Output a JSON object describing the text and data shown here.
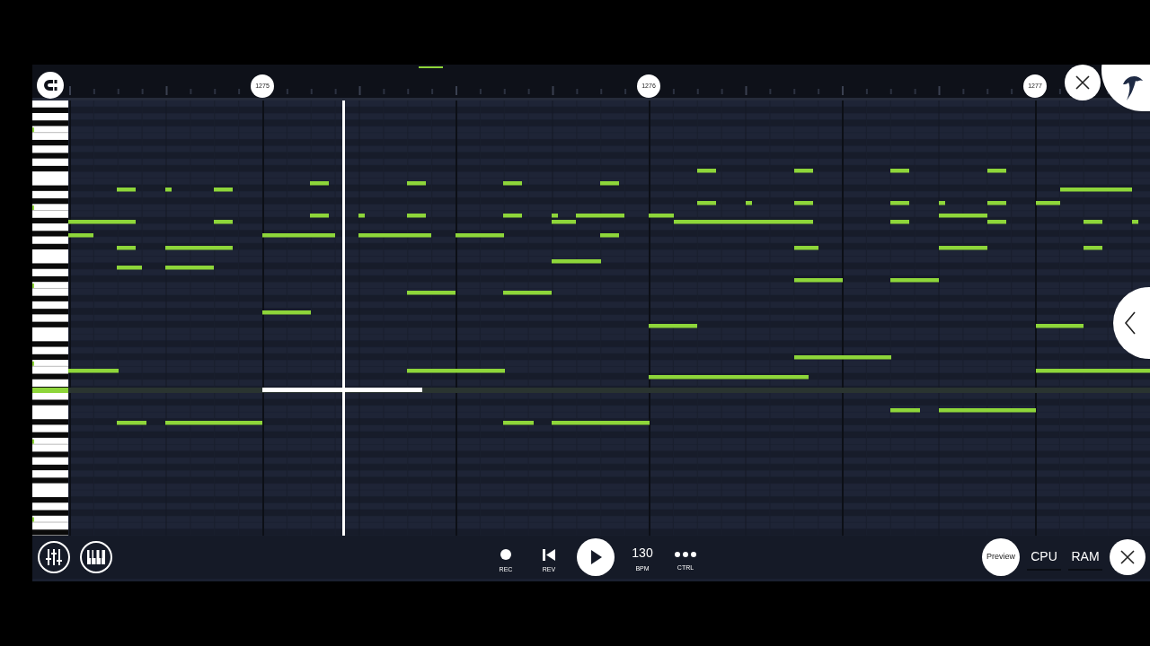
{
  "ruler": {
    "markers": [
      "1275",
      "1276",
      "1277"
    ]
  },
  "transport": [
    {
      "kind": "record",
      "label": "REC"
    },
    {
      "kind": "rewind",
      "label": "REV"
    },
    {
      "kind": "play"
    },
    {
      "kind": "tempo",
      "value": "130",
      "label": "BPM"
    },
    {
      "kind": "more",
      "label": "CTRL"
    }
  ],
  "preview_button": "Preview",
  "meters": [
    "CPU",
    "RAM"
  ]
}
